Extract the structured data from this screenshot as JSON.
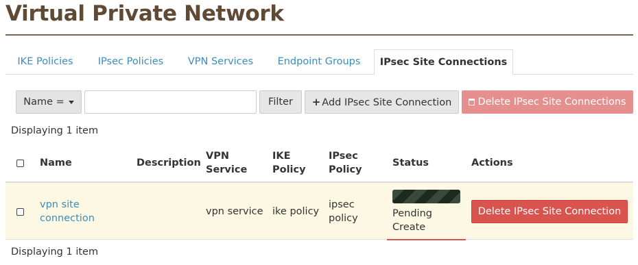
{
  "page": {
    "title": "Virtual Private Network"
  },
  "tabs": [
    {
      "label": "IKE Policies",
      "active": false
    },
    {
      "label": "IPsec Policies",
      "active": false
    },
    {
      "label": "VPN Services",
      "active": false
    },
    {
      "label": "Endpoint Groups",
      "active": false
    },
    {
      "label": "IPsec Site Connections",
      "active": true
    }
  ],
  "toolbar": {
    "filter_field_label": "Name =",
    "filter_input_value": "",
    "filter_button": "Filter",
    "add_button": "Add IPsec Site Connection",
    "delete_button": "Delete IPsec Site Connections"
  },
  "table": {
    "count_top": "Displaying 1 item",
    "count_bottom": "Displaying 1 item",
    "columns": {
      "name": "Name",
      "description": "Description",
      "vpn_service_1": "VPN",
      "vpn_service_2": "Service",
      "ike_policy_1": "IKE",
      "ike_policy_2": "Policy",
      "ipsec_policy_1": "IPsec",
      "ipsec_policy_2": "Policy",
      "status": "Status",
      "actions": "Actions"
    },
    "rows": [
      {
        "name_1": "vpn site",
        "name_2": "connection",
        "description": "",
        "vpn_service": "vpn service",
        "ike_policy": "ike policy",
        "ipsec_policy_1": "ipsec",
        "ipsec_policy_2": "policy",
        "status_1": "Pending",
        "status_2": "Create",
        "action": "Delete IPsec Site Connection"
      }
    ]
  },
  "colors": {
    "title": "#5f4a36",
    "link": "#3b8dbd",
    "danger": "#d9534f",
    "danger_disabled": "#e68f8f",
    "row_highlight": "#fcf8e3"
  }
}
